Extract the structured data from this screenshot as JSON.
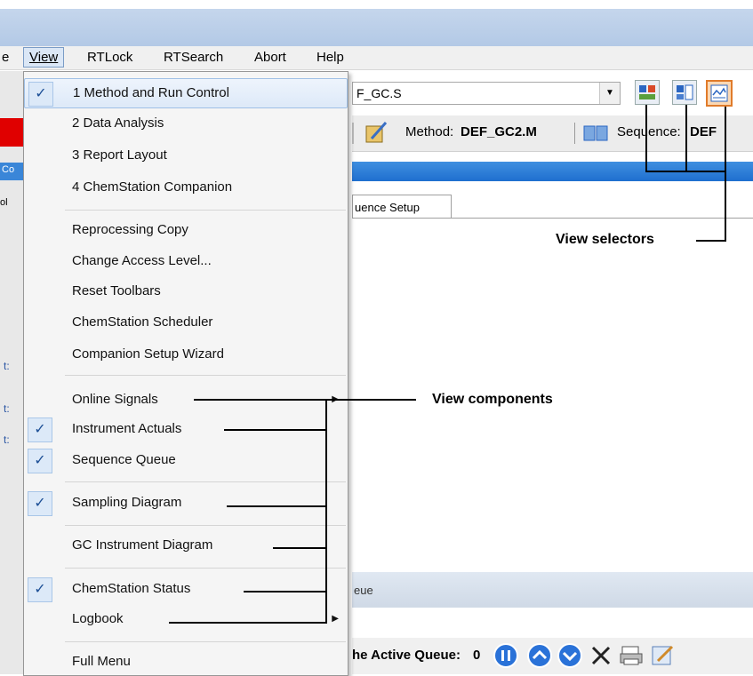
{
  "menubar": {
    "partial_item": "e",
    "items": [
      {
        "label": "View"
      },
      {
        "label": "RTLock"
      },
      {
        "label": "RTSearch"
      },
      {
        "label": "Abort"
      },
      {
        "label": "Help"
      }
    ]
  },
  "background": {
    "method_combo_value": "F_GC.S",
    "method_label": "Method:",
    "method_value": "DEF_GC2.M",
    "sequence_label": "Sequence:",
    "sequence_value": "DEF",
    "tab_label": "uence Setup",
    "queue_label": "eue",
    "status_label": "he Active Queue:",
    "status_count": "0",
    "left_labels": [
      "Co",
      "ol",
      "t:",
      "t:",
      "t:"
    ]
  },
  "view_menu": {
    "items": [
      {
        "label": "1 Method and Run Control",
        "checked": true
      },
      {
        "label": "2 Data Analysis",
        "checked": false
      },
      {
        "label": "3 Report Layout",
        "checked": false
      },
      {
        "label": "4 ChemStation Companion",
        "checked": false
      },
      {
        "label": "Reprocessing Copy",
        "checked": false
      },
      {
        "label": "Change Access Level...",
        "checked": false
      },
      {
        "label": "Reset Toolbars",
        "checked": false
      },
      {
        "label": "ChemStation Scheduler",
        "checked": false
      },
      {
        "label": "Companion Setup Wizard",
        "checked": false
      },
      {
        "label": "Online Signals",
        "checked": false,
        "submenu": true
      },
      {
        "label": "Instrument Actuals",
        "checked": true
      },
      {
        "label": "Sequence Queue",
        "checked": true
      },
      {
        "label": "Sampling Diagram",
        "checked": true
      },
      {
        "label": "GC Instrument Diagram",
        "checked": false
      },
      {
        "label": "ChemStation Status",
        "checked": true
      },
      {
        "label": "Logbook",
        "checked": false,
        "submenu": true
      },
      {
        "label": "Full Menu",
        "checked": false
      }
    ]
  },
  "annotations": {
    "view_selectors": "View selectors",
    "view_components": "View components"
  },
  "icons": {
    "check": "checkmark-icon",
    "submenu": "submenu-arrow-icon"
  },
  "colors": {
    "menu_highlight": "#dde9f8",
    "check_bg": "#dce9f8",
    "accent_red": "#e00000",
    "accent_blue": "#1f6fcf"
  }
}
